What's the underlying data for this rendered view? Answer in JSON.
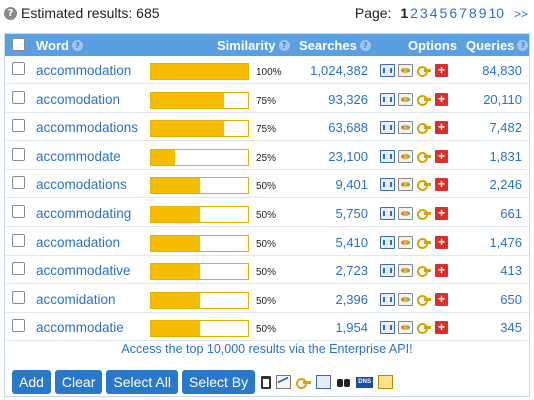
{
  "summary": {
    "label": "Estimated results: 685"
  },
  "pager": {
    "label": "Page:",
    "pages": [
      "1",
      "2",
      "3",
      "4",
      "5",
      "6",
      "7",
      "8",
      "9",
      "10"
    ],
    "current": "1",
    "next": ">>"
  },
  "table": {
    "headers": {
      "word": "Word",
      "similarity": "Similarity",
      "searches": "Searches",
      "options": "Options",
      "queries": "Queries"
    },
    "rows": [
      {
        "word": "accommodation",
        "similarity": 100,
        "similarity_label": "100%",
        "searches": "1,024,382",
        "queries": "84,830"
      },
      {
        "word": "accomodation",
        "similarity": 75,
        "similarity_label": "75%",
        "searches": "93,326",
        "queries": "20,110"
      },
      {
        "word": "accommodations",
        "similarity": 75,
        "similarity_label": "75%",
        "searches": "63,688",
        "queries": "7,482"
      },
      {
        "word": "accommodate",
        "similarity": 25,
        "similarity_label": "25%",
        "searches": "23,100",
        "queries": "1,831"
      },
      {
        "word": "accomodations",
        "similarity": 50,
        "similarity_label": "50%",
        "searches": "9,401",
        "queries": "2,246"
      },
      {
        "word": "accommodating",
        "similarity": 50,
        "similarity_label": "50%",
        "searches": "5,750",
        "queries": "661"
      },
      {
        "word": "accomadation",
        "similarity": 50,
        "similarity_label": "50%",
        "searches": "5,410",
        "queries": "1,476"
      },
      {
        "word": "accommodative",
        "similarity": 50,
        "similarity_label": "50%",
        "searches": "2,723",
        "queries": "413"
      },
      {
        "word": "accomidation",
        "similarity": 50,
        "similarity_label": "50%",
        "searches": "2,396",
        "queries": "650"
      },
      {
        "word": "accommodatie",
        "similarity": 50,
        "similarity_label": "50%",
        "searches": "1,954",
        "queries": "345"
      }
    ],
    "row_icons": [
      "chart-icon",
      "trend-icon",
      "keys-icon",
      "add-icon"
    ],
    "add_icon_glyph": "+"
  },
  "footnote": "Access the top 10,000 results via the Enterprise API!",
  "buttons": {
    "add": "Add",
    "clear": "Clear",
    "select_all": "Select All",
    "select_by": "Select By"
  },
  "toolbar_icons": [
    "trash-icon",
    "graph-icon",
    "key-icon",
    "move-icon",
    "binoculars-icon",
    "dns-icon",
    "list-icon"
  ],
  "dns_icon_text": "DNS",
  "help_glyph": "?",
  "colors": {
    "accent": "#2a78c8",
    "header_bg": "#5a9fe0",
    "bar_fill": "#f6bd00",
    "link": "#2a72c7",
    "add_red": "#d9302c"
  }
}
